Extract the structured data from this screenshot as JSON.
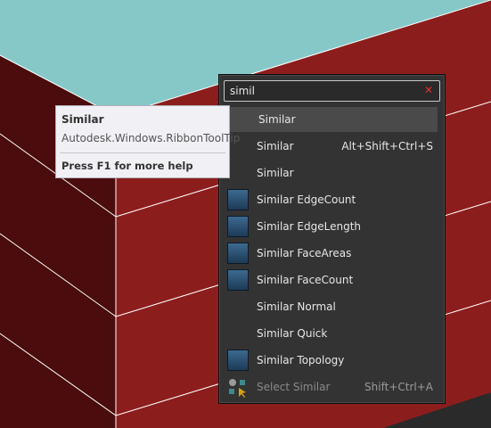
{
  "search": {
    "value": "simil"
  },
  "results": [
    {
      "label": "Similar",
      "shortcut": "",
      "icon": "none",
      "selected": true,
      "enabled": true
    },
    {
      "label": "Similar",
      "shortcut": "Alt+Shift+Ctrl+S",
      "icon": "none",
      "selected": false,
      "enabled": true
    },
    {
      "label": "Similar",
      "shortcut": "",
      "icon": "none",
      "selected": false,
      "enabled": true
    },
    {
      "label": "Similar EdgeCount",
      "shortcut": "",
      "icon": "blue-thumbnail-icon",
      "selected": false,
      "enabled": true
    },
    {
      "label": "Similar EdgeLength",
      "shortcut": "",
      "icon": "blue-thumbnail-icon",
      "selected": false,
      "enabled": true
    },
    {
      "label": "Similar FaceAreas",
      "shortcut": "",
      "icon": "blue-thumbnail-icon",
      "selected": false,
      "enabled": true
    },
    {
      "label": "Similar FaceCount",
      "shortcut": "",
      "icon": "blue-thumbnail-icon",
      "selected": false,
      "enabled": true
    },
    {
      "label": "Similar Normal",
      "shortcut": "",
      "icon": "none",
      "selected": false,
      "enabled": true
    },
    {
      "label": "Similar Quick",
      "shortcut": "",
      "icon": "none",
      "selected": false,
      "enabled": true
    },
    {
      "label": "Similar Topology",
      "shortcut": "",
      "icon": "blue-thumbnail-icon",
      "selected": false,
      "enabled": true
    },
    {
      "label": "Select Similar",
      "shortcut": "Shift+Ctrl+A",
      "icon": "select-similar-icon",
      "selected": false,
      "enabled": false
    }
  ],
  "tooltip": {
    "title": "Similar",
    "subtitle": "Autodesk.Windows.RibbonToolTip",
    "help": "Press F1 for more help"
  },
  "colors": {
    "sky": "#86c8c8",
    "wall_front": "#8c1d1d",
    "wall_side": "#4a0c0c",
    "popup_bg": "#333333",
    "accent": "#2a7fc0"
  }
}
